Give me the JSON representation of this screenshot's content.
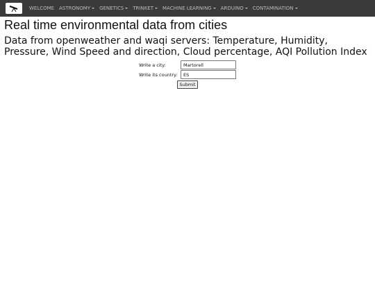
{
  "nav": {
    "items": [
      {
        "label": "WELCOME",
        "has_caret": false
      },
      {
        "label": "ASTRONOMY",
        "has_caret": true
      },
      {
        "label": "GENETICS",
        "has_caret": true
      },
      {
        "label": "TRINKET",
        "has_caret": true
      },
      {
        "label": "MACHINE LEARNING",
        "has_caret": true
      },
      {
        "label": "ARDUINO",
        "has_caret": true
      },
      {
        "label": "CONTAMINATION",
        "has_caret": true
      }
    ],
    "logo_icon": "telescope-icon",
    "background": "#3a3a3a"
  },
  "page": {
    "title": "Real time environmental data from cities",
    "subtitle": "Data from openweather and waqi servers: Temperature, Humidity, Pressure, Wind Speed and direction, Cloud percentage, AQI Pollution Index"
  },
  "form": {
    "city_label": "Write a city:",
    "city_value": "Martorell",
    "country_label": "Write its country:",
    "country_value": "ES",
    "submit_label": "Submit"
  }
}
